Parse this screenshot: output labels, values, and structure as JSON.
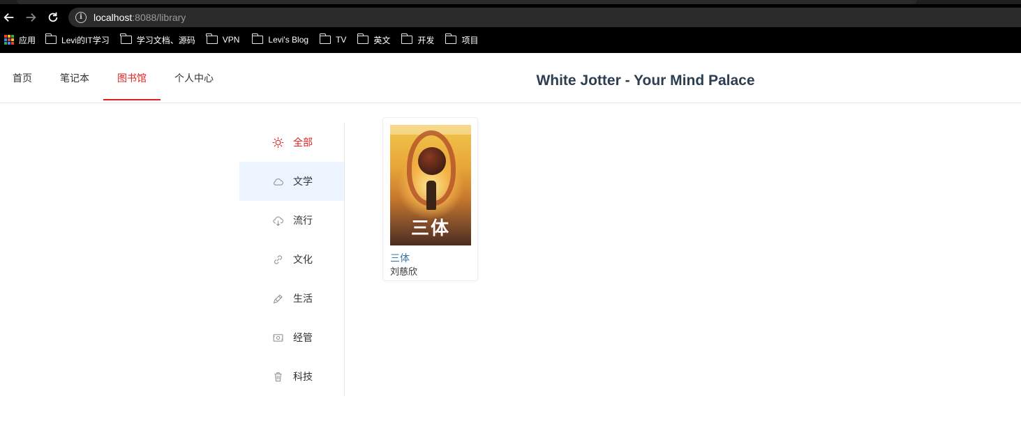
{
  "browser": {
    "url_host": "localhost",
    "url_rest": ":8088/library",
    "bookmarks": [
      {
        "label": "应用",
        "icon": "apps-grid-icon"
      },
      {
        "label": "Levi的IT学习",
        "icon": "folder-icon"
      },
      {
        "label": "学习文档、源码",
        "icon": "folder-icon"
      },
      {
        "label": "VPN",
        "icon": "folder-icon"
      },
      {
        "label": "Levi's Blog",
        "icon": "folder-icon"
      },
      {
        "label": "TV",
        "icon": "folder-icon"
      },
      {
        "label": "英文",
        "icon": "folder-icon"
      },
      {
        "label": "开发",
        "icon": "folder-icon"
      },
      {
        "label": "项目",
        "icon": "folder-icon"
      }
    ]
  },
  "header": {
    "menu": [
      {
        "label": "首页",
        "active": false
      },
      {
        "label": "笔记本",
        "active": false
      },
      {
        "label": "图书馆",
        "active": true
      },
      {
        "label": "个人中心",
        "active": false
      }
    ],
    "title": "White Jotter - Your Mind Palace",
    "accent_color": "#e02020"
  },
  "categories": [
    {
      "label": "全部",
      "icon": "sun-icon",
      "active": true
    },
    {
      "label": "文学",
      "icon": "cloud-icon",
      "hover": true
    },
    {
      "label": "流行",
      "icon": "cloud-download-icon"
    },
    {
      "label": "文化",
      "icon": "link-icon"
    },
    {
      "label": "生活",
      "icon": "pen-icon"
    },
    {
      "label": "经管",
      "icon": "money-icon"
    },
    {
      "label": "科技",
      "icon": "delete-icon"
    }
  ],
  "books": [
    {
      "title": "三体",
      "author": "刘慈欣",
      "cover_text": "三体"
    }
  ]
}
